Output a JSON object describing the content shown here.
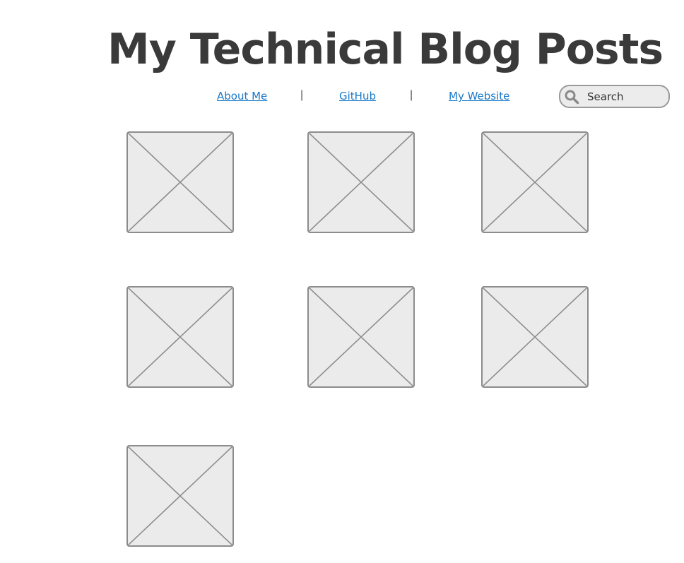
{
  "header": {
    "title": "My Technical Blog Posts"
  },
  "nav": {
    "links": [
      {
        "label": "About Me"
      },
      {
        "label": "GitHub"
      },
      {
        "label": "My Website"
      }
    ],
    "separator": "|"
  },
  "search": {
    "placeholder": "Search",
    "icon": "search-icon"
  },
  "posts": {
    "count": 7,
    "thumbnail_icon": "image-placeholder-icon"
  },
  "colors": {
    "title": "#3a3a3a",
    "link": "#1a78c8",
    "placeholder_fill": "#ebebeb",
    "placeholder_stroke": "#8c8c8c"
  }
}
